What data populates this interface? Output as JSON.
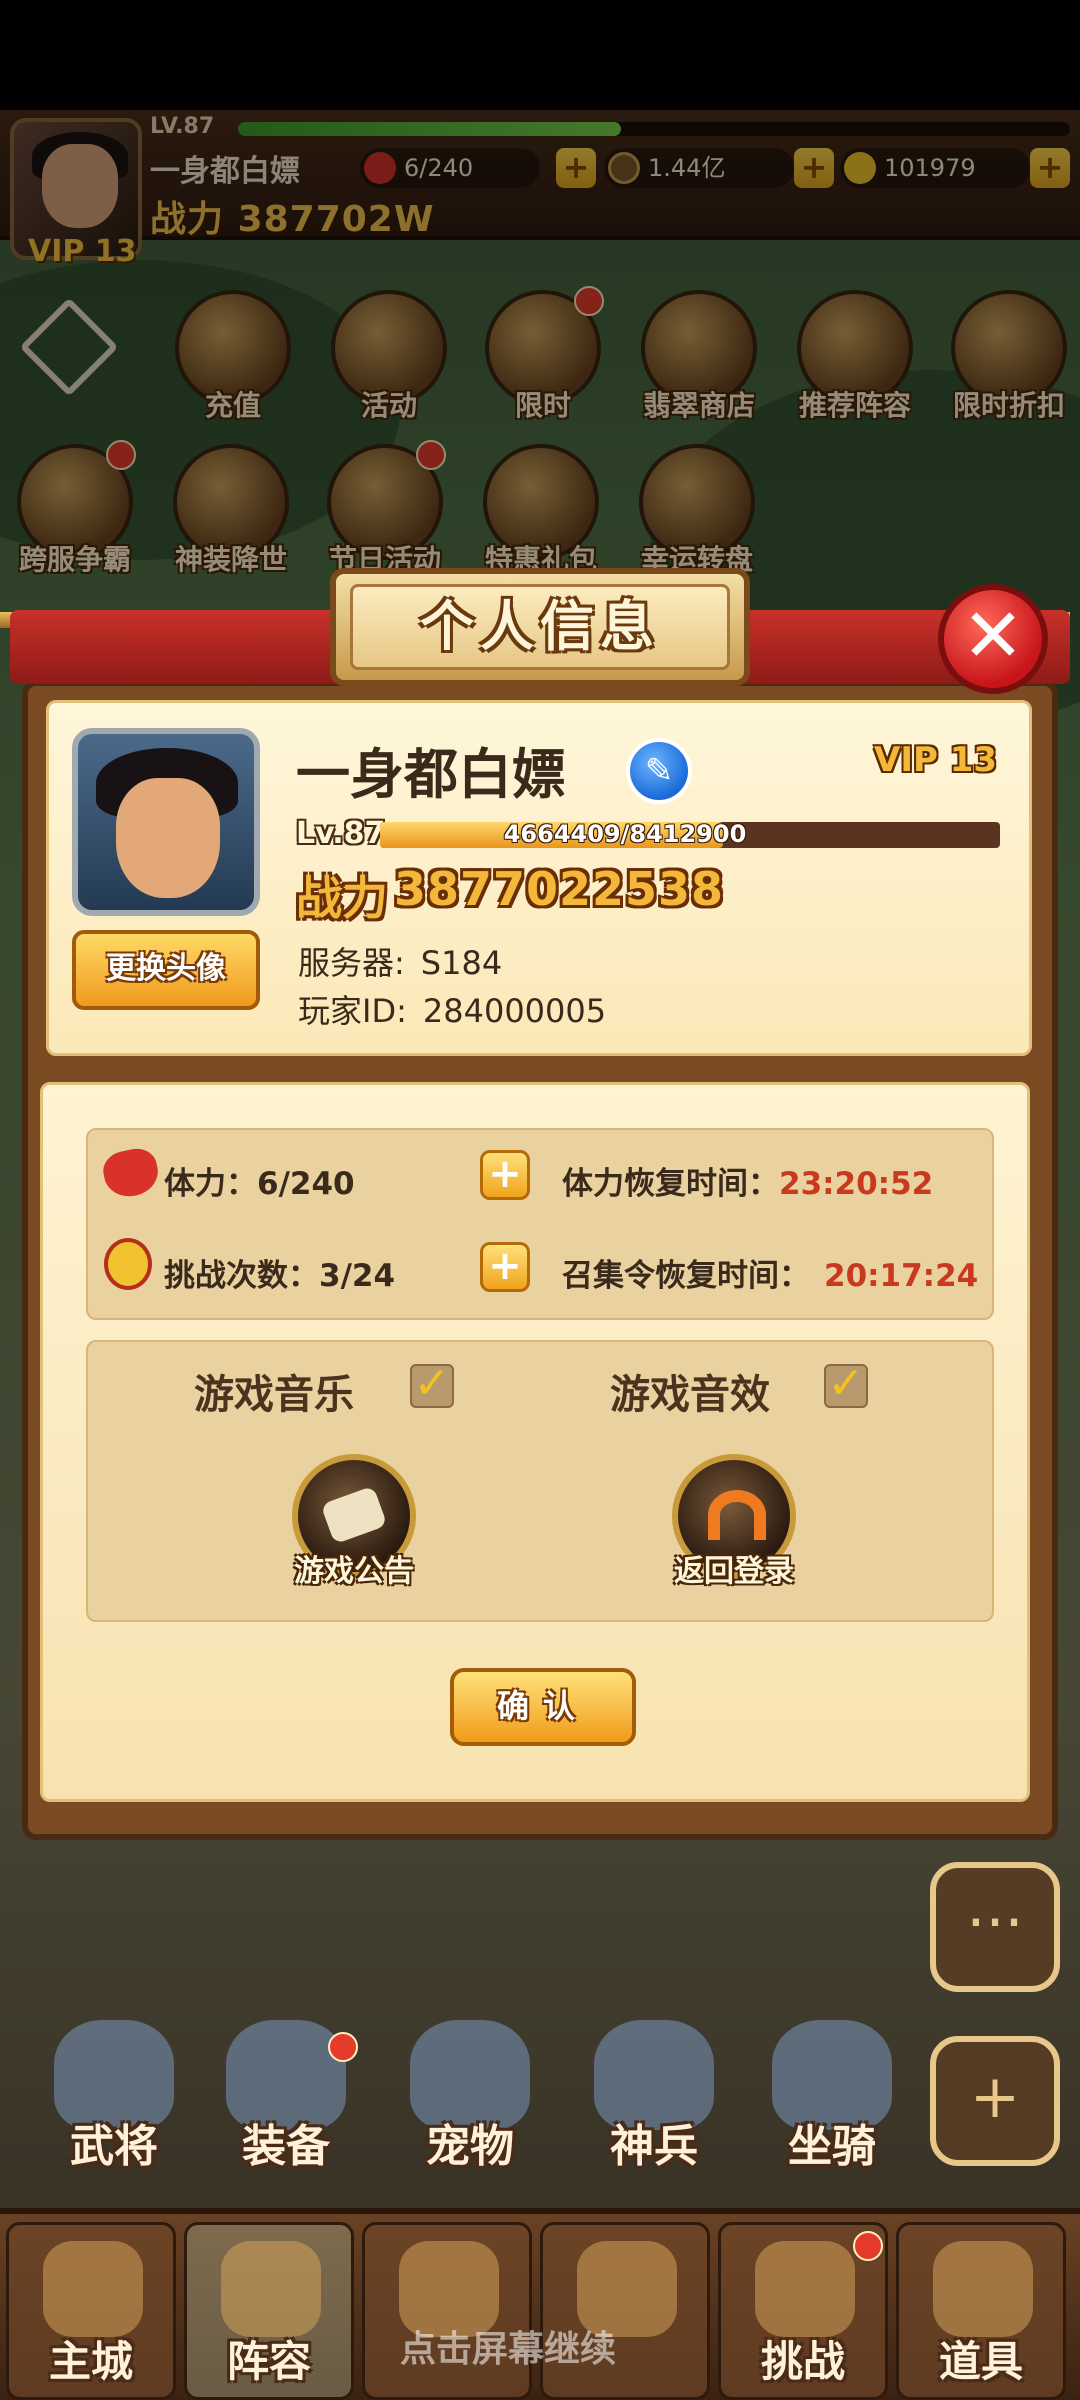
{
  "top_bar": {
    "level": "LV.87",
    "player_name": "一身都白嫖",
    "power_label": "战力",
    "power_value": "387702W",
    "vip": "VIP 13",
    "exp_fraction": 0.46,
    "stamina": "6/240",
    "gold": "1.44亿",
    "gems": "101979",
    "plus": "+"
  },
  "features": [
    {
      "label": "充值",
      "icon": "gold-ingot-icon"
    },
    {
      "label": "活动",
      "icon": "horn-icon"
    },
    {
      "label": "限时",
      "icon": "treasure-chest-icon"
    },
    {
      "label": "翡翠商店",
      "icon": "jade-shop-icon"
    },
    {
      "label": "推荐阵容",
      "icon": "crossed-swords-icon"
    },
    {
      "label": "限时折扣",
      "icon": "hourglass-icon"
    },
    {
      "label": "跨服争霸",
      "icon": "crossed-weapons-icon"
    },
    {
      "label": "神装降世",
      "icon": "armor-icon"
    },
    {
      "label": "节日活动",
      "icon": "festival-icon"
    },
    {
      "label": "特惠礼包",
      "icon": "gift-box-icon"
    },
    {
      "label": "幸运转盘",
      "icon": "wheel-icon"
    }
  ],
  "modal": {
    "title": "个人信息",
    "close": "✕",
    "player_name": "一身都白嫖",
    "edit_icon": "✎",
    "vip": "VIP 13",
    "change_avatar": "更换头像",
    "level": "Lv.87",
    "exp_text": "4664409/8412900",
    "exp_fraction": 0.554,
    "power_label": "战力",
    "power_value": "3877022538",
    "server_label": "服务器:",
    "server_value": "S184",
    "player_id_label": "玩家ID:",
    "player_id_value": "284000005",
    "stats": {
      "stamina_label": "体力：6/240",
      "challenge_label": "挑战次数：3/24",
      "stamina_recover_label": "体力恢复时间：",
      "stamina_recover_time": "23:20:52",
      "summon_recover_label": "召集令恢复时间：",
      "summon_recover_time": "20:17:24",
      "plus": "+"
    },
    "settings": {
      "music_label": "游戏音乐",
      "sfx_label": "游戏音效",
      "check": "✓",
      "notice_label": "游戏公告",
      "back_login_label": "返回登录"
    },
    "confirm": "确认"
  },
  "side_buttons": {
    "chat": "···",
    "add": "+"
  },
  "heroes": [
    "武将",
    "装备",
    "宠物",
    "神兵",
    "坐骑"
  ],
  "nav": [
    "主城",
    "阵容",
    "",
    "",
    "挑战",
    "道具"
  ],
  "overlay_note": "点击屏幕继续"
}
